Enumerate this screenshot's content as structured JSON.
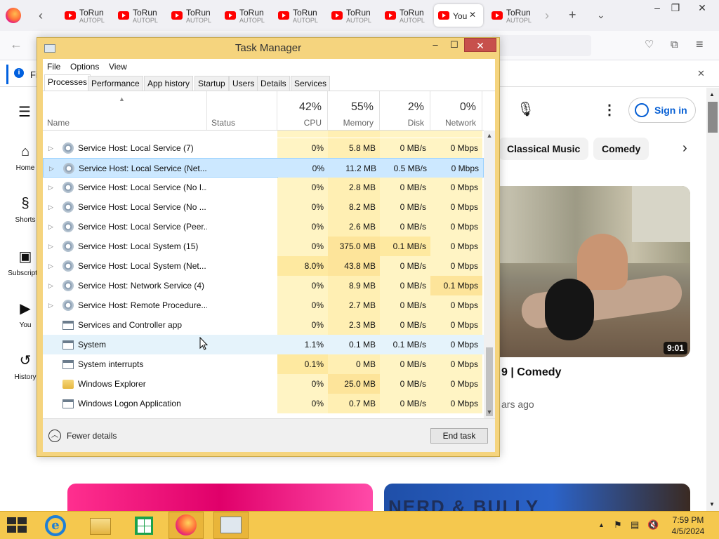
{
  "browser": {
    "tabs": [
      {
        "title": "ToRun",
        "subtitle": "AUTOPL"
      },
      {
        "title": "ToRun",
        "subtitle": "AUTOPL"
      },
      {
        "title": "ToRun",
        "subtitle": "AUTOPL"
      },
      {
        "title": "ToRun",
        "subtitle": "AUTOPL"
      },
      {
        "title": "ToRun",
        "subtitle": "AUTOPL"
      },
      {
        "title": "ToRun",
        "subtitle": "AUTOPL"
      },
      {
        "title": "ToRun",
        "subtitle": "AUTOPL"
      },
      {
        "title": "You",
        "subtitle": ""
      },
      {
        "title": "ToRun",
        "subtitle": "AUTOPL"
      }
    ],
    "notification_text": "Fi"
  },
  "youtube": {
    "sidebar": [
      {
        "label": "Home",
        "icon": "home-icon"
      },
      {
        "label": "Shorts",
        "icon": "shorts-icon"
      },
      {
        "label": "Subscriptio",
        "icon": "subscriptions-icon"
      },
      {
        "label": "You",
        "icon": "you-icon"
      },
      {
        "label": "History",
        "icon": "history-icon"
      }
    ],
    "chips": [
      "Classical Music",
      "Comedy"
    ],
    "sign_in": "Sign in",
    "video": {
      "duration": "9:01",
      "title_fragment": "9 | Comedy",
      "age_fragment": "ars ago"
    },
    "card2_text": "NERD & BULLY"
  },
  "taskmanager": {
    "title": "Task Manager",
    "menu": [
      "File",
      "Options",
      "View"
    ],
    "tabs": [
      "Processes",
      "Performance",
      "App history",
      "Startup",
      "Users",
      "Details",
      "Services"
    ],
    "active_tab": "Processes",
    "columns": {
      "name": "Name",
      "status": "Status",
      "cpu": {
        "label": "CPU",
        "pct": "42%"
      },
      "memory": {
        "label": "Memory",
        "pct": "55%"
      },
      "disk": {
        "label": "Disk",
        "pct": "2%"
      },
      "network": {
        "label": "Network",
        "pct": "0%"
      }
    },
    "rows": [
      {
        "name": "Service Host: Local Service (7)",
        "cpu": "0%",
        "memory": "5.8 MB",
        "disk": "0 MB/s",
        "network": "0 Mbps",
        "expandable": true,
        "icon": "gear"
      },
      {
        "name": "Service Host: Local Service (Net...",
        "cpu": "0%",
        "memory": "11.2 MB",
        "disk": "0.5 MB/s",
        "network": "0 Mbps",
        "expandable": true,
        "icon": "gear",
        "selected": true
      },
      {
        "name": "Service Host: Local Service (No I...",
        "cpu": "0%",
        "memory": "2.8 MB",
        "disk": "0 MB/s",
        "network": "0 Mbps",
        "expandable": true,
        "icon": "gear"
      },
      {
        "name": "Service Host: Local Service (No ...",
        "cpu": "0%",
        "memory": "8.2 MB",
        "disk": "0 MB/s",
        "network": "0 Mbps",
        "expandable": true,
        "icon": "gear"
      },
      {
        "name": "Service Host: Local Service (Peer...",
        "cpu": "0%",
        "memory": "2.6 MB",
        "disk": "0 MB/s",
        "network": "0 Mbps",
        "expandable": true,
        "icon": "gear"
      },
      {
        "name": "Service Host: Local System (15)",
        "cpu": "0%",
        "memory": "375.0 MB",
        "disk": "0.1 MB/s",
        "network": "0 Mbps",
        "expandable": true,
        "icon": "gear"
      },
      {
        "name": "Service Host: Local System (Net...",
        "cpu": "8.0%",
        "memory": "43.8 MB",
        "disk": "0 MB/s",
        "network": "0 Mbps",
        "expandable": true,
        "icon": "gear"
      },
      {
        "name": "Service Host: Network Service (4)",
        "cpu": "0%",
        "memory": "8.9 MB",
        "disk": "0 MB/s",
        "network": "0.1 Mbps",
        "expandable": true,
        "icon": "gear"
      },
      {
        "name": "Service Host: Remote Procedure...",
        "cpu": "0%",
        "memory": "2.7 MB",
        "disk": "0 MB/s",
        "network": "0 Mbps",
        "expandable": true,
        "icon": "gear"
      },
      {
        "name": "Services and Controller app",
        "cpu": "0%",
        "memory": "2.3 MB",
        "disk": "0 MB/s",
        "network": "0 Mbps",
        "expandable": false,
        "icon": "win"
      },
      {
        "name": "System",
        "cpu": "1.1%",
        "memory": "0.1 MB",
        "disk": "0.1 MB/s",
        "network": "0 Mbps",
        "expandable": false,
        "icon": "win",
        "hover": true
      },
      {
        "name": "System interrupts",
        "cpu": "0.1%",
        "memory": "0 MB",
        "disk": "0 MB/s",
        "network": "0 Mbps",
        "expandable": false,
        "icon": "win"
      },
      {
        "name": "Windows Explorer",
        "cpu": "0%",
        "memory": "25.0 MB",
        "disk": "0 MB/s",
        "network": "0 Mbps",
        "expandable": false,
        "icon": "folder"
      },
      {
        "name": "Windows Logon Application",
        "cpu": "0%",
        "memory": "0.7 MB",
        "disk": "0 MB/s",
        "network": "0 Mbps",
        "expandable": false,
        "icon": "win"
      }
    ],
    "fewer_details": "Fewer details",
    "end_task": "End task"
  },
  "taskbar": {
    "time": "7:59 PM",
    "date": "4/5/2024"
  }
}
